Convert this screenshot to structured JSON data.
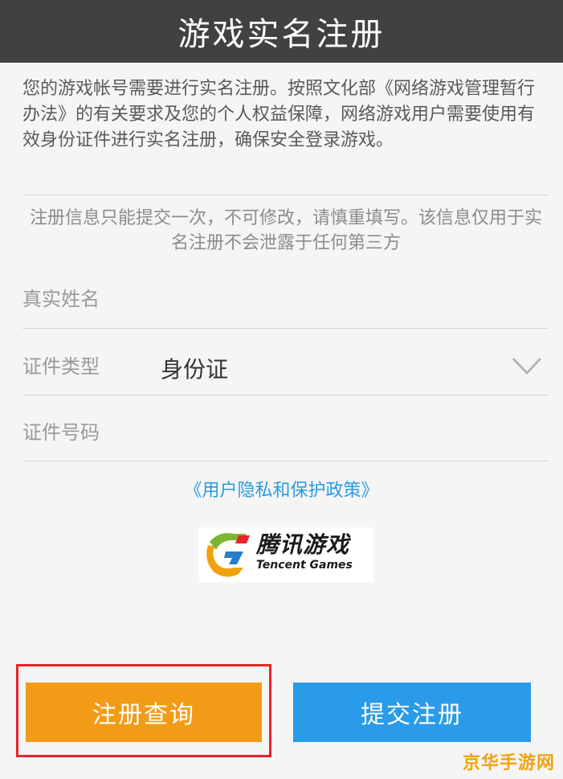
{
  "header": {
    "title": "游戏实名注册"
  },
  "intro": {
    "text": "您的游戏帐号需要进行实名注册。按照文化部《网络游戏管理暂行办法》的有关要求及您的个人权益保障，网络游戏用户需要使用有效身份证件进行实名注册，确保安全登录游戏。"
  },
  "notice": {
    "text": "注册信息只能提交一次，不可修改，请慎重填写。该信息仅用于实名注册不会泄露于任何第三方"
  },
  "form": {
    "real_name": {
      "placeholder": "真实姓名"
    },
    "id_type": {
      "label": "证件类型",
      "value": "身份证"
    },
    "id_number": {
      "placeholder": "证件号码"
    }
  },
  "policy_link": "《用户隐私和保护政策》",
  "logo": {
    "cn": "腾讯游戏",
    "en": "Tencent Games"
  },
  "buttons": {
    "query": "注册查询",
    "submit": "提交注册"
  },
  "watermark": "京华手游网",
  "colors": {
    "header_bg": "#404142",
    "query_button": "#f29b16",
    "submit_button": "#2a9be8",
    "link": "#2a9be0",
    "highlight_border": "#e8242a",
    "watermark": "#f2a20c"
  }
}
